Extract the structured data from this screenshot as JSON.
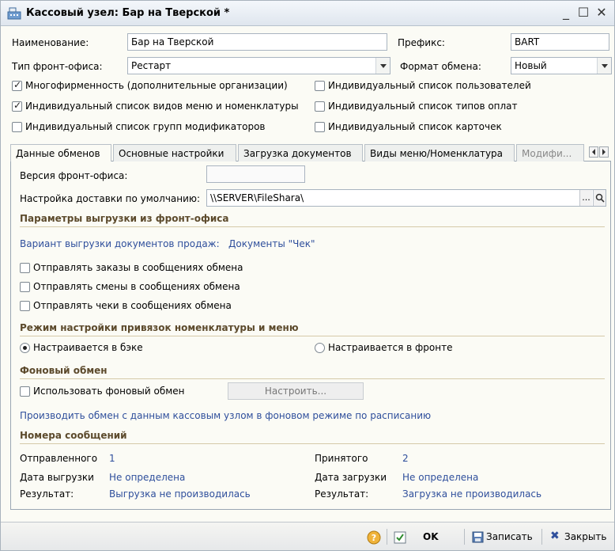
{
  "window": {
    "title": "Кассовый узел: Бар на Тверской *"
  },
  "form": {
    "name_label": "Наименование:",
    "name_value": "Бар на Тверской",
    "prefix_label": "Префикс:",
    "prefix_value": "BART",
    "frontoffice_type_label": "Тип фронт-офиса:",
    "frontoffice_type_value": "Рестарт",
    "exchange_format_label": "Формат обмена:",
    "exchange_format_value": "Новый",
    "checkboxes": [
      {
        "label": "Многофирменность (дополнительные организации)",
        "checked": true
      },
      {
        "label": "Индивидуальный список пользователей",
        "checked": false
      },
      {
        "label": "Индивидуальный список видов меню и номенклатуры",
        "checked": true
      },
      {
        "label": "Индивидуальный список типов оплат",
        "checked": false
      },
      {
        "label": "Индивидуальный список групп модификаторов",
        "checked": false
      },
      {
        "label": "Индивидуальный список карточек",
        "checked": false
      }
    ]
  },
  "tabs": [
    {
      "label": "Данные обменов",
      "active": true
    },
    {
      "label": "Основные настройки",
      "active": false
    },
    {
      "label": "Загрузка документов",
      "active": false
    },
    {
      "label": "Виды меню/Номенклатура",
      "active": false
    },
    {
      "label": "Модифи...",
      "active": false
    }
  ],
  "exchange": {
    "frontoffice_version_label": "Версия фронт-офиса:",
    "frontoffice_version_value": "",
    "delivery_label": "Настройка доставки по умолчанию:",
    "delivery_value": "\\\\SERVER\\FileShara\\",
    "lookup_button": "...",
    "upload_section": "Параметры выгрузки из фронт-офиса",
    "upload_variant_label": "Вариант выгрузки документов продаж:",
    "upload_variant_value": "Документы \"Чек\"",
    "send_orders_label": "Отправлять заказы в сообщениях обмена",
    "send_shifts_label": "Отправлять смены в сообщениях обмена",
    "send_checks_label": "Отправлять чеки в сообщениях обмена",
    "binding_section": "Режим настройки привязок номенклатуры и меню",
    "radio_back_label": "Настраивается в бэке",
    "radio_front_label": "Настраивается в фронте",
    "bg_section": "Фоновый обмен",
    "bg_use_label": "Использовать фоновый обмен",
    "bg_configure_button": "Настроить...",
    "bg_info_link": "Производить обмен с данным кассовым узлом в фоновом режиме по расписанию",
    "msg_section": "Номера сообщений",
    "sent_label": "Отправленного",
    "sent_value": "1",
    "received_label": "Принятого",
    "received_value": "2",
    "upload_date_label": "Дата выгрузки",
    "upload_date_value": "Не определена",
    "download_date_label": "Дата загрузки",
    "download_date_value": "Не определена",
    "result_label_1": "Результат:",
    "upload_result_value": "Выгрузка не производилась",
    "result_label_2": "Результат:",
    "download_result_value": "Загрузка не производилась"
  },
  "footer": {
    "ok_label": "OK",
    "save_label": "Записать",
    "close_label": "Закрыть"
  },
  "colors": {
    "accent_link": "#2f4f9c",
    "section_title": "#5c4a2c"
  }
}
